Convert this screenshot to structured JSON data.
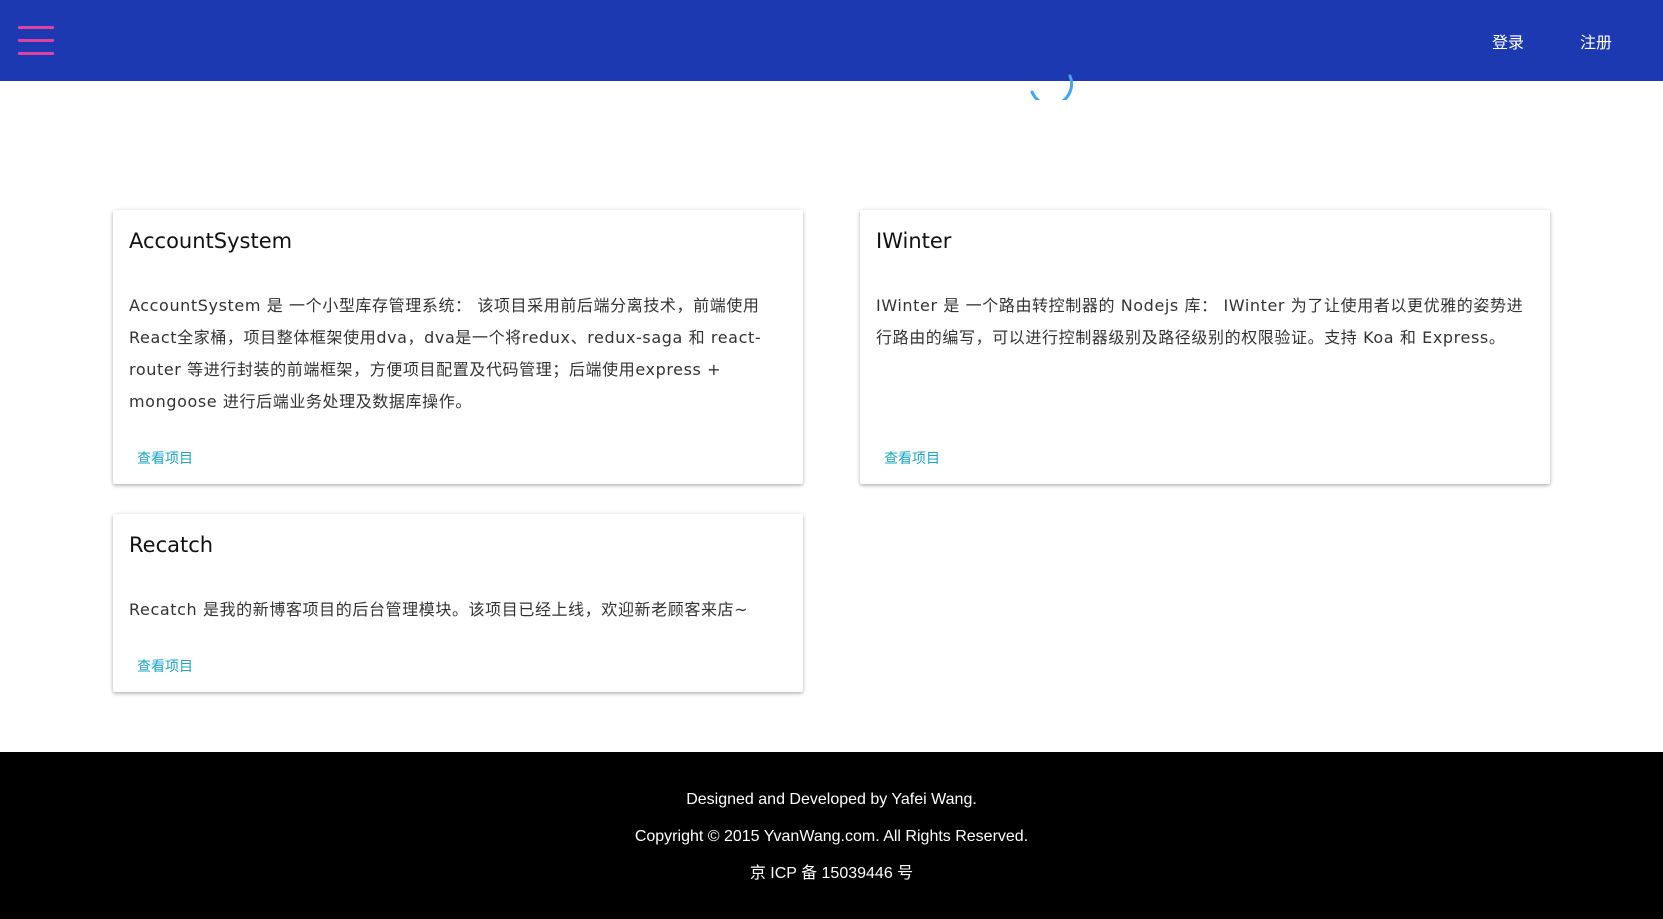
{
  "header": {
    "menu_icon": "hamburger-menu-icon",
    "login_label": "登录",
    "register_label": "注册",
    "background_color": "#1c39b1",
    "menu_icon_color": "#e040a0"
  },
  "loading": {
    "icon": "loading-spinner-icon",
    "color": "#42a5f5"
  },
  "projects": [
    {
      "title": "AccountSystem",
      "description": "AccountSystem 是 一个小型库存管理系统： 该项目采用前后端分离技术，前端使用React全家桶，项目整体框架使用dva，dva是一个将redux、redux-saga 和 react-router 等进行封装的前端框架，方便项目配置及代码管理；后端使用express + mongoose 进行后端业务处理及数据库操作。",
      "link_label": "查看项目"
    },
    {
      "title": "IWinter",
      "description": "IWinter 是 一个路由转控制器的 Nodejs 库： IWinter 为了让使用者以更优雅的姿势进行路由的编写，可以进行控制器级别及路径级别的权限验证。支持 Koa 和 Express。",
      "link_label": "查看项目"
    },
    {
      "title": "Recatch",
      "description": "Recatch 是我的新博客项目的后台管理模块。该项目已经上线，欢迎新老顾客来店~",
      "link_label": "查看项目"
    }
  ],
  "footer": {
    "line1": "Designed and Developed by Yafei Wang.",
    "line2": "Copyright © 2015 YvanWang.com. All Rights Reserved.",
    "line3": "京 ICP 备 15039446 号"
  },
  "colors": {
    "link": "#17a8c8",
    "footer_bg": "#000000"
  }
}
